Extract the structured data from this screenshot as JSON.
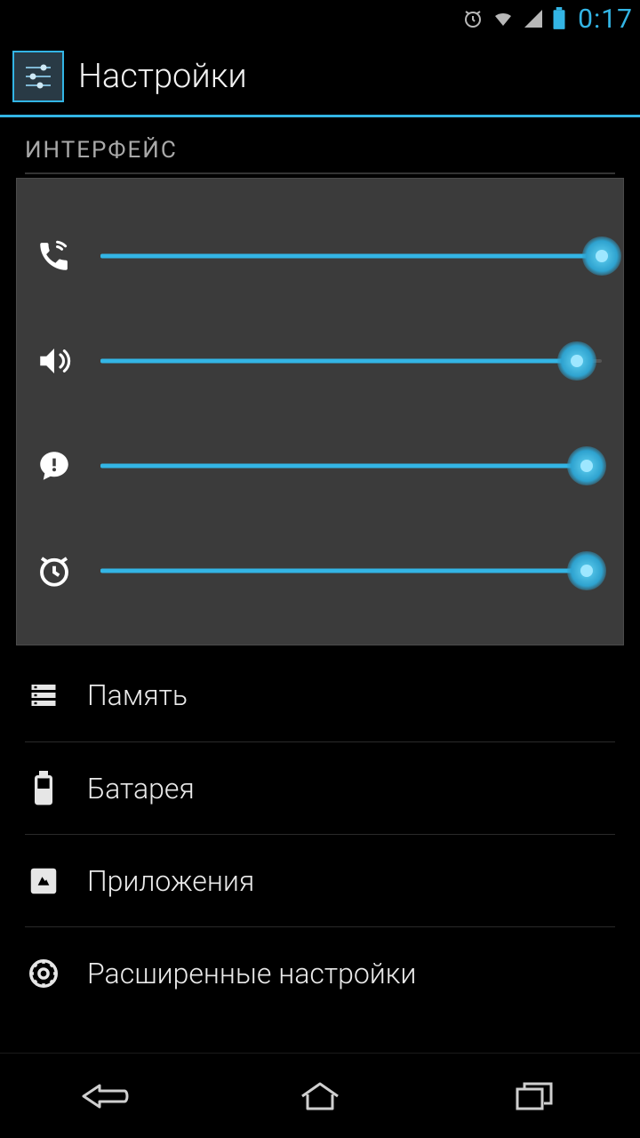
{
  "status": {
    "time": "0:17"
  },
  "header": {
    "title": "Настройки"
  },
  "section": {
    "label": "ИНТЕРФЕЙС"
  },
  "volume": {
    "sliders": [
      {
        "icon": "phone-icon",
        "value": 100
      },
      {
        "icon": "speaker-icon",
        "value": 95
      },
      {
        "icon": "notification-icon",
        "value": 97
      },
      {
        "icon": "alarm-icon",
        "value": 97
      }
    ]
  },
  "settings_items": [
    {
      "icon": "storage-icon",
      "label": "Память"
    },
    {
      "icon": "battery-icon",
      "label": "Батарея"
    },
    {
      "icon": "apps-icon",
      "label": "Приложения"
    },
    {
      "icon": "gear-icon",
      "label": "Расширенные настройки"
    }
  ],
  "colors": {
    "accent": "#33b5e5"
  }
}
